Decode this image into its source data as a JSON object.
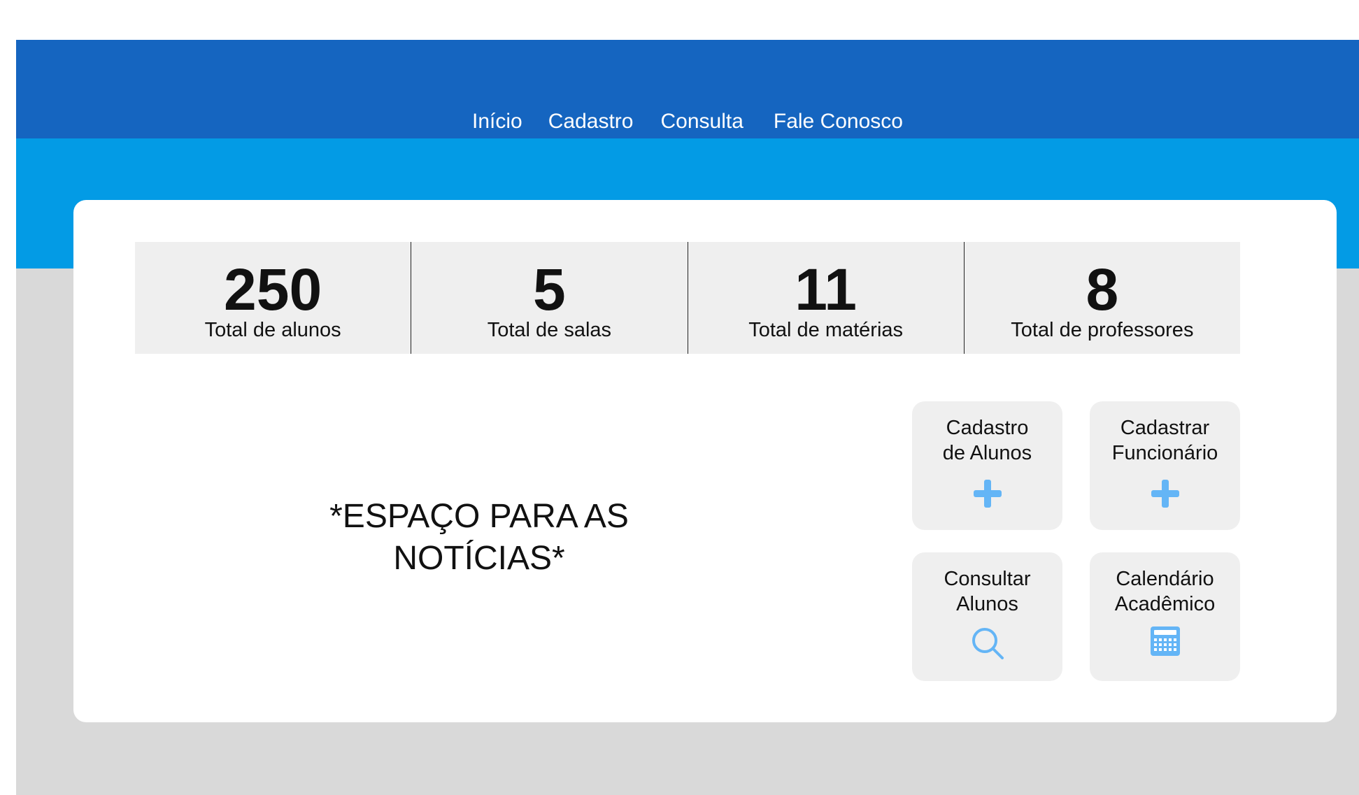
{
  "nav": {
    "items": [
      "Início",
      "Cadastro",
      "Consulta",
      "Fale Conosco"
    ]
  },
  "stats": [
    {
      "value": "250",
      "label": "Total de alunos"
    },
    {
      "value": "5",
      "label": "Total de salas"
    },
    {
      "value": "11",
      "label": "Total de matérias"
    },
    {
      "value": "8",
      "label": "Total de professores"
    }
  ],
  "news": {
    "line1": "*ESPAÇO PARA AS",
    "line2": "NOTÍCIAS*"
  },
  "actions": [
    {
      "line1": "Cadastro",
      "line2": "de Alunos",
      "icon": "plus-icon"
    },
    {
      "line1": "Cadastrar",
      "line2": "Funcionário",
      "icon": "plus-icon"
    },
    {
      "line1": "Consultar",
      "line2": "Alunos",
      "icon": "search-icon"
    },
    {
      "line1": "Calendário",
      "line2": "Acadêmico",
      "icon": "calendar-icon"
    }
  ],
  "colors": {
    "topbar": "#1565c0",
    "subbar": "#039be5",
    "background": "#d9d9d9",
    "icon": "#64b5f6"
  }
}
